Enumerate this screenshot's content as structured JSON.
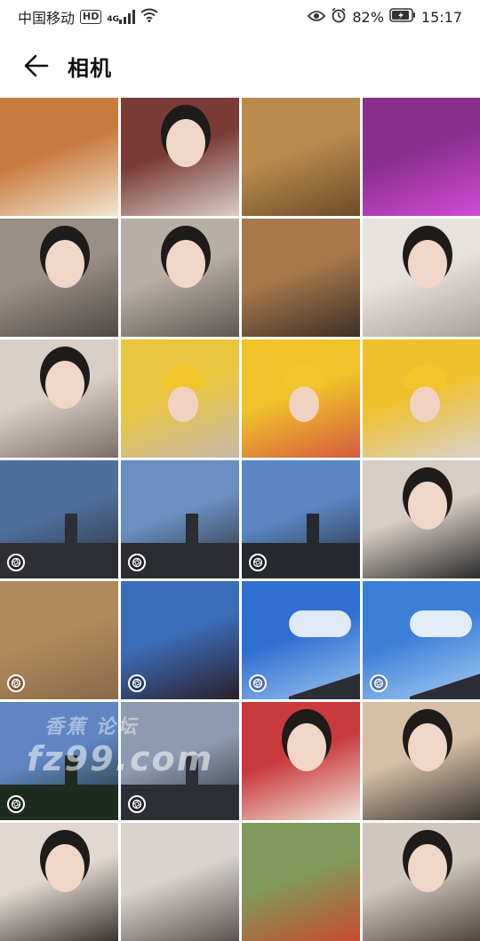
{
  "status_bar": {
    "carrier": "中国移动",
    "hd": "HD",
    "network": "4G",
    "battery": "82%",
    "time": "15:17",
    "icons": [
      "eye-icon",
      "alarm-icon",
      "battery-icon"
    ]
  },
  "header": {
    "title": "相机",
    "back_icon": "arrow-left-icon"
  },
  "grid": {
    "columns": 4,
    "photos": [
      {
        "desc": "dish",
        "colors": [
          "#c97a3e",
          "#f1e6d0"
        ],
        "badge": false
      },
      {
        "desc": "girl-reading",
        "colors": [
          "#7a3b36",
          "#d8cfc5"
        ],
        "badge": false
      },
      {
        "desc": "wood-floor",
        "colors": [
          "#b98a4c",
          "#6e4c2a"
        ],
        "badge": false
      },
      {
        "desc": "purple-room",
        "colors": [
          "#8a2f8e",
          "#d24bd6"
        ],
        "badge": false
      },
      {
        "desc": "gym-selfie",
        "colors": [
          "#9a8f85",
          "#4f4a46"
        ],
        "badge": false
      },
      {
        "desc": "gym-selfie-2",
        "colors": [
          "#b7aea4",
          "#5d5853"
        ],
        "badge": false
      },
      {
        "desc": "floor-stretch",
        "colors": [
          "#a8784b",
          "#3d2f26"
        ],
        "badge": false
      },
      {
        "desc": "glasses-selfie",
        "colors": [
          "#e8e2dc",
          "#a9a09a"
        ],
        "badge": false
      },
      {
        "desc": "glasses-selfie-2",
        "colors": [
          "#d8d0c8",
          "#7b6e66"
        ],
        "badge": false
      },
      {
        "desc": "yellow-hat-1",
        "colors": [
          "#e9c540",
          "#c8b8aa"
        ],
        "badge": false
      },
      {
        "desc": "yellow-hat-2",
        "colors": [
          "#f1c32a",
          "#d45a3f"
        ],
        "badge": false
      },
      {
        "desc": "yellow-hat-3",
        "colors": [
          "#f0c02c",
          "#d9d2cb"
        ],
        "badge": false
      },
      {
        "desc": "sky-tower-1",
        "colors": [
          "#4e6f9d",
          "#2d2f34"
        ],
        "badge": true
      },
      {
        "desc": "sky-tower-2",
        "colors": [
          "#6a8fc0",
          "#2b2d33"
        ],
        "badge": true
      },
      {
        "desc": "sky-tower-3",
        "colors": [
          "#5a86c4",
          "#26292f"
        ],
        "badge": true
      },
      {
        "desc": "face-selfie",
        "colors": [
          "#d8cdc4",
          "#2a2a2a"
        ],
        "badge": false
      },
      {
        "desc": "metro-station",
        "colors": [
          "#b08a5b",
          "#8a6a47"
        ],
        "badge": true
      },
      {
        "desc": "poster",
        "colors": [
          "#3c6db8",
          "#2a1f2a"
        ],
        "badge": true
      },
      {
        "desc": "blue-sky-clouds",
        "colors": [
          "#2f6fd1",
          "#9cc3ef"
        ],
        "badge": true
      },
      {
        "desc": "blue-sky-clouds-2",
        "colors": [
          "#3b7fd8",
          "#a6cbf1"
        ],
        "badge": true
      },
      {
        "desc": "dusk-sky",
        "colors": [
          "#5d86c2",
          "#1e2b1f"
        ],
        "badge": true
      },
      {
        "desc": "dusk-street",
        "colors": [
          "#8d9bb0",
          "#2c2f36"
        ],
        "badge": true
      },
      {
        "desc": "red-top-girl",
        "colors": [
          "#c93a3d",
          "#f1e5da"
        ],
        "badge": false
      },
      {
        "desc": "couple",
        "colors": [
          "#d5bfa6",
          "#3b3531"
        ],
        "badge": false
      },
      {
        "desc": "partial-1",
        "colors": [
          "#e0d8d0",
          "#3a3431"
        ],
        "badge": false
      },
      {
        "desc": "partial-2",
        "colors": [
          "#d8d3cf",
          "#5b5450"
        ],
        "badge": false
      },
      {
        "desc": "partial-3",
        "colors": [
          "#7f9a5a",
          "#c94b2f"
        ],
        "badge": false
      },
      {
        "desc": "partial-4",
        "colors": [
          "#cfc6bd",
          "#50463f"
        ],
        "badge": false
      }
    ]
  },
  "watermark": {
    "line1": "香蕉 论坛",
    "line2": "fz99.com"
  }
}
